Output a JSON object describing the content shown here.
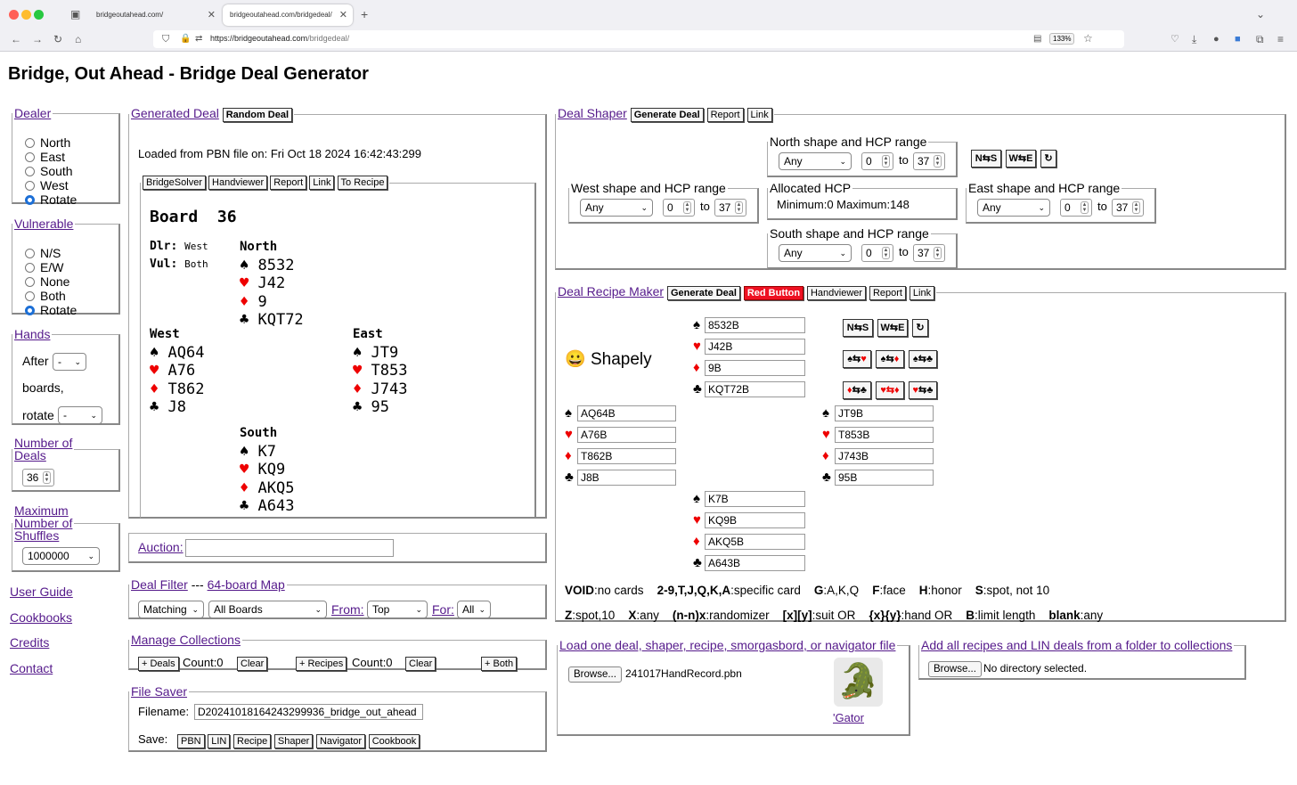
{
  "browser": {
    "tabs": [
      {
        "label": "bridgeoutahead.com/"
      },
      {
        "label": "bridgeoutahead.com/bridgedeal/"
      }
    ],
    "url_host": "https://bridgeoutahead.com",
    "url_path": "/bridgedeal/",
    "zoom": "133%"
  },
  "page_title": "Bridge, Out Ahead - Bridge Deal Generator",
  "dealer": {
    "legend": "Dealer",
    "options": [
      "North",
      "East",
      "South",
      "West",
      "Rotate"
    ],
    "selected": "Rotate"
  },
  "vulnerable": {
    "legend": "Vulnerable",
    "options": [
      "N/S",
      "E/W",
      "None",
      "Both",
      "Rotate"
    ],
    "selected": "Rotate"
  },
  "hands": {
    "legend": "Hands",
    "after": "After",
    "after_value": "-",
    "boards": "boards,",
    "rotate": "rotate",
    "rotate_value": "-"
  },
  "number_of_deals": {
    "legend_1": "Number of",
    "legend_2": "Deals",
    "value": "36"
  },
  "max_shuffles": {
    "legend_1": "Maximum",
    "legend_2": "Number of",
    "legend_3": "Shuffles",
    "value": "1000000"
  },
  "nav": {
    "user_guide": "User Guide",
    "cookbooks": "Cookbooks",
    "credits": "Credits",
    "contact": "Contact"
  },
  "generated_deal": {
    "legend": "Generated Deal",
    "random_button": "Random Deal",
    "loaded_text": "Loaded from PBN file on: Fri Oct 18 2024 16:42:43:299",
    "buttons": [
      "BridgeSolver",
      "Handviewer",
      "Report",
      "Link",
      "To Recipe"
    ],
    "board_label": "Board",
    "board_number": "36",
    "dlr_label": "Dlr:",
    "dlr_value": "West",
    "vul_label": "Vul:",
    "vul_value": "Both",
    "north": {
      "name": "North",
      "s": "8532",
      "h": "J42",
      "d": "9",
      "c": "KQT72"
    },
    "west": {
      "name": "West",
      "s": "AQ64",
      "h": "A76",
      "d": "T862",
      "c": "J8"
    },
    "east": {
      "name": "East",
      "s": "JT9",
      "h": "T853",
      "d": "J743",
      "c": "95"
    },
    "south": {
      "name": "South",
      "s": "K7",
      "h": "KQ9",
      "d": "AKQ5",
      "c": "A643"
    }
  },
  "auction": {
    "label": "Auction:",
    "value": ""
  },
  "deal_filter": {
    "legend_1": "Deal Filter",
    "sep": "---",
    "legend_2": "64-board Map",
    "matching": "Matching",
    "all_boards": "All Boards",
    "from_label": "From:",
    "from_value": "Top",
    "for_label": "For:",
    "for_value": "All"
  },
  "manage": {
    "legend": "Manage Collections",
    "deals_btn": "+ Deals",
    "count_label": "Count:0",
    "clear": "Clear",
    "recipes_btn": "+ Recipes",
    "count2_label": "Count:0",
    "clear2": "Clear",
    "both_btn": "+ Both"
  },
  "file_saver": {
    "legend": "File Saver",
    "filename_label": "Filename:",
    "filename_value": "D20241018164243299936_bridge_out_ahead",
    "save_label": "Save:",
    "buttons": [
      "PBN",
      "LIN",
      "Recipe",
      "Shaper",
      "Navigator",
      "Cookbook"
    ]
  },
  "shaper": {
    "legend": "Deal Shaper",
    "buttons": [
      "Generate Deal",
      "Report",
      "Link"
    ],
    "north_legend": "North shape and HCP range",
    "west_legend": "West shape and HCP range",
    "east_legend": "East shape and HCP range",
    "south_legend": "South shape and HCP range",
    "any": "Any",
    "min": "0",
    "to": "to",
    "max": "37",
    "alloc_legend": "Allocated HCP",
    "alloc_text": "Minimum:0 Maximum:148",
    "rot_ns": "N⇆S",
    "rot_we": "W⇆E",
    "rot_cw": "↻"
  },
  "recipe": {
    "legend": "Deal Recipe Maker",
    "buttons": [
      "Generate Deal",
      "Red Button",
      "Handviewer",
      "Report",
      "Link"
    ],
    "emoji": "😀",
    "shape_label": "Shapely",
    "north": [
      "8532B",
      "J42B",
      "9B",
      "KQT72B"
    ],
    "west": [
      "AQ64B",
      "A76B",
      "T862B",
      "J8B"
    ],
    "east": [
      "JT9B",
      "T853B",
      "J743B",
      "95B"
    ],
    "south": [
      "K7B",
      "KQ9B",
      "AKQ5B",
      "A643B"
    ],
    "legend_line1": [
      [
        "VOID",
        ":no cards"
      ],
      [
        "2-9,T,J,Q,K,A",
        ":specific card"
      ],
      [
        "G",
        ":A,K,Q"
      ],
      [
        "F",
        ":face"
      ],
      [
        "H",
        ":honor"
      ],
      [
        "S",
        ":spot, not 10"
      ]
    ],
    "legend_line2": [
      [
        "Z",
        ":spot,10"
      ],
      [
        "X",
        ":any"
      ],
      [
        "(n-n)x",
        ":randomizer"
      ],
      [
        "[x][y]",
        ":suit OR"
      ],
      [
        "{x}{y}",
        ":hand OR"
      ],
      [
        "B",
        ":limit length"
      ],
      [
        "blank",
        ":any"
      ]
    ]
  },
  "load": {
    "legend": "Load one deal, shaper, recipe, smorgasbord, or navigator file",
    "browse": "Browse...",
    "file": "241017HandRecord.pbn",
    "gator": "'Gator"
  },
  "folder": {
    "legend": "Add all recipes and LIN deals from a folder to collections",
    "browse": "Browse...",
    "status": "No directory selected."
  },
  "colors": {
    "link": "#551a8b",
    "radio": "#1c6fd6",
    "red_button": "#ee1122",
    "suit_red": "#ee0000"
  }
}
